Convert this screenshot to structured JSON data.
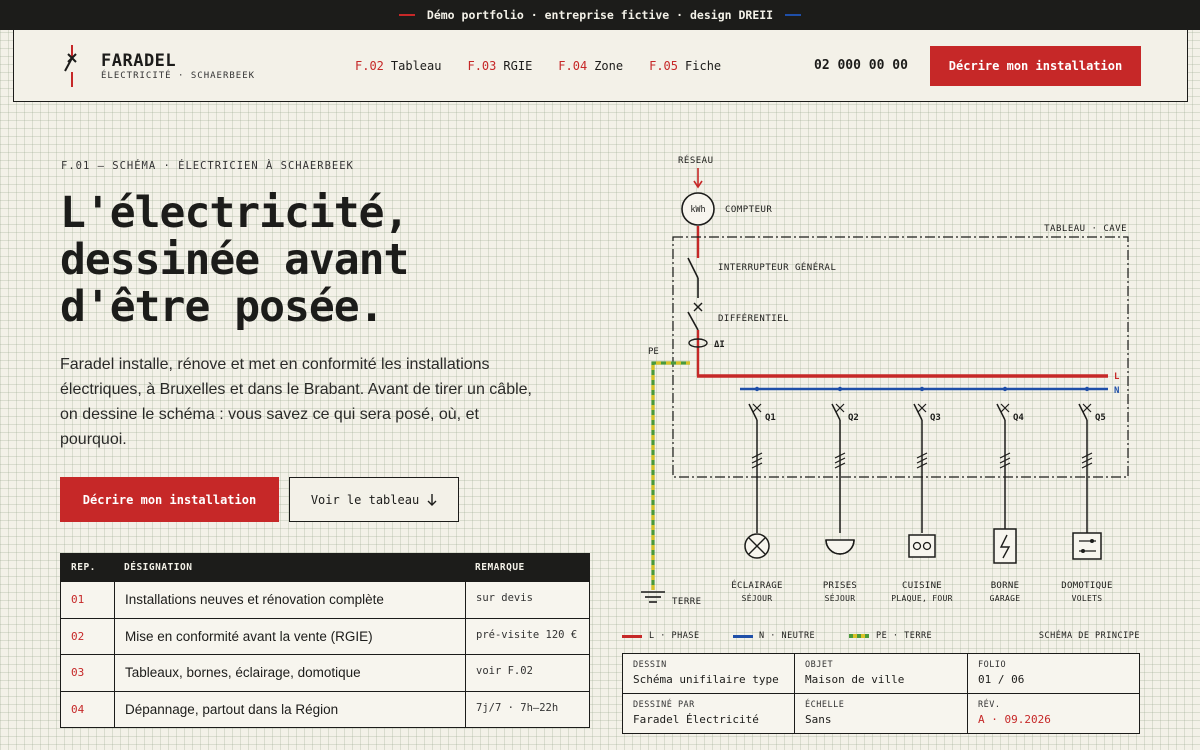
{
  "banner": {
    "text": "Démo portfolio · entreprise fictive · design DREII",
    "colors": {
      "left_dash": "#c62828",
      "right_dash": "#1f4fa8"
    }
  },
  "brand": {
    "name": "FARADEL",
    "subtitle": "ÉLECTRICITÉ · SCHAERBEEK"
  },
  "nav": {
    "items": [
      {
        "code": "F.02",
        "label": "Tableau"
      },
      {
        "code": "F.03",
        "label": "RGIE"
      },
      {
        "code": "F.04",
        "label": "Zone"
      },
      {
        "code": "F.05",
        "label": "Fiche"
      }
    ]
  },
  "header": {
    "phone": "02 000 00 00",
    "cta": "Décrire mon installation"
  },
  "hero": {
    "eyebrow": "F.01 — SCHÉMA · ÉLECTRICIEN À SCHAERBEEK",
    "headline": [
      "L'électricité,",
      "dessinée avant",
      "d'être posée."
    ],
    "lede": "Faradel installe, rénove et met en conformité les installations électriques, à Bruxelles et dans le Brabant. Avant de tirer un câble, on dessine le schéma : vous savez ce qui sera posé, où, et pourquoi.",
    "primary_cta": "Décrire mon installation",
    "secondary_cta": "Voir le tableau",
    "secondary_icon": "arrow-down-icon"
  },
  "services": {
    "headers": {
      "rep": "REP.",
      "designation": "DÉSIGNATION",
      "remarque": "REMARQUE"
    },
    "rows": [
      {
        "rep": "01",
        "designation": "Installations neuves et rénovation complète",
        "remarque": "sur devis"
      },
      {
        "rep": "02",
        "designation": "Mise en conformité avant la vente (RGIE)",
        "remarque": "pré-visite 120 €"
      },
      {
        "rep": "03",
        "designation": "Tableaux, bornes, éclairage, domotique",
        "remarque": "voir F.02"
      },
      {
        "rep": "04",
        "designation": "Dépannage, partout dans la Région",
        "remarque": "7j/7 · 7h–22h"
      }
    ]
  },
  "diagram": {
    "reseau": "RÉSEAU",
    "meter": "kWh",
    "meter_label": "COMPTEUR",
    "panel_label": "TABLEAU · CAVE",
    "main_switch": "INTERRUPTEUR GÉNÉRAL",
    "differential": "DIFFÉRENTIEL",
    "delta": "ΔI",
    "pe": "PE",
    "l": "L",
    "n": "N",
    "earth": "TERRE",
    "circuits": [
      {
        "id": "Q1",
        "name": "ÉCLAIRAGE",
        "sub": "SÉJOUR",
        "icon": "lamp-icon"
      },
      {
        "id": "Q2",
        "name": "PRISES",
        "sub": "SÉJOUR",
        "icon": "socket-icon"
      },
      {
        "id": "Q3",
        "name": "CUISINE",
        "sub": "PLAQUE, FOUR",
        "icon": "cooker-icon"
      },
      {
        "id": "Q4",
        "name": "BORNE",
        "sub": "GARAGE",
        "icon": "charger-icon"
      },
      {
        "id": "Q5",
        "name": "DOMOTIQUE",
        "sub": "VOLETS",
        "icon": "home-automation-icon"
      }
    ],
    "colors": {
      "phase": "#c62828",
      "neutral": "#1f4fa8",
      "earth_green": "#4a9a3a",
      "earth_yellow": "#d9c227"
    }
  },
  "legend": {
    "items": [
      {
        "label": "L · PHASE",
        "color": "#c62828"
      },
      {
        "label": "N · NEUTRE",
        "color": "#1f4fa8"
      },
      {
        "label": "PE · TERRE",
        "color": "#4a9a3a"
      }
    ],
    "caption": "SCHÉMA DE PRINCIPE"
  },
  "title_block": {
    "dessin_k": "DESSIN",
    "dessin_v": "Schéma unifilaire type",
    "objet_k": "OBJET",
    "objet_v": "Maison de ville",
    "folio_k": "FOLIO",
    "folio_v": "01 / 06",
    "par_k": "DESSINÉ PAR",
    "par_v": "Faradel Électricité",
    "echelle_k": "ÉCHELLE",
    "echelle_v": "Sans",
    "rev_k": "RÉV.",
    "rev_v": "A · 09.2026"
  },
  "accent": "#c62828"
}
